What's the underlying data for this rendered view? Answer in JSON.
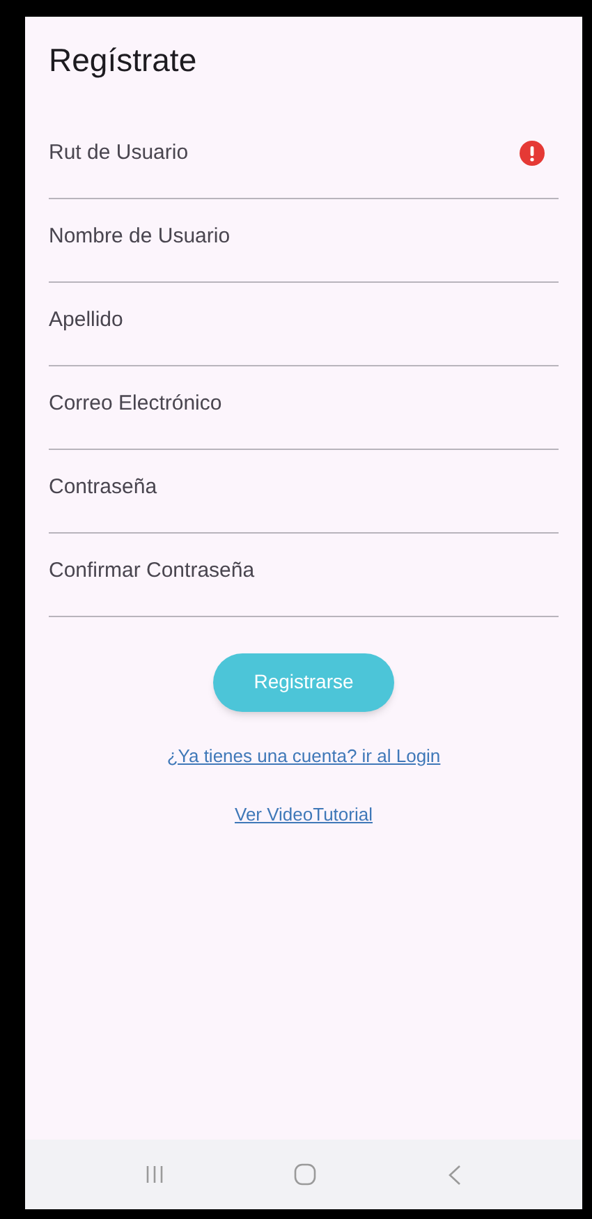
{
  "title": "Regístrate",
  "fields": [
    {
      "label": "Rut de Usuario",
      "error": true
    },
    {
      "label": "Nombre de Usuario",
      "error": false
    },
    {
      "label": "Apellido",
      "error": false
    },
    {
      "label": "Correo Electrónico",
      "error": false
    },
    {
      "label": "Contraseña",
      "error": false
    },
    {
      "label": "Confirmar Contraseña",
      "error": false
    }
  ],
  "button": "Registrarse",
  "links": [
    "¿Ya tienes una cuenta? ir al Login",
    "Ver VideoTutorial"
  ]
}
